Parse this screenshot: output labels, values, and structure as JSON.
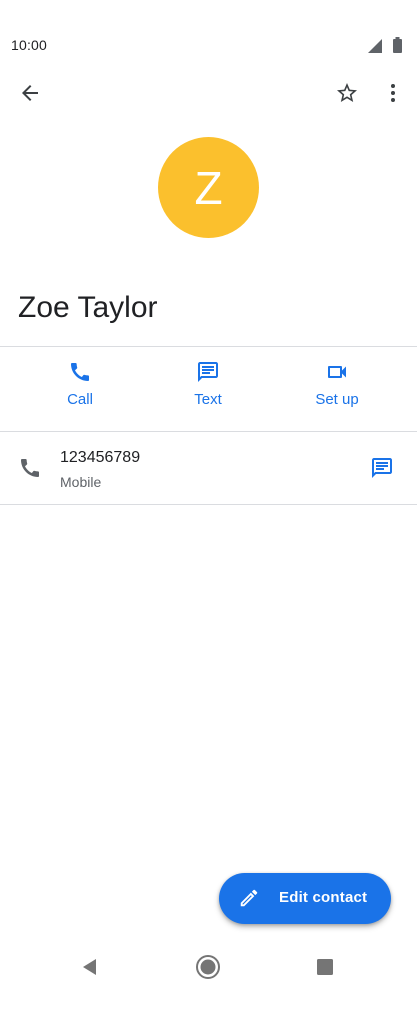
{
  "status_bar": {
    "time": "10:00",
    "signal_icon": "signal-icon",
    "battery_icon": "battery-icon"
  },
  "app_bar": {
    "back_icon": "arrow-back-icon",
    "favorite_icon": "star-outline-icon",
    "more_icon": "more-vert-icon"
  },
  "contact": {
    "avatar_letter": "Z",
    "avatar_color": "#fbc02d",
    "name": "Zoe Taylor"
  },
  "actions": [
    {
      "label": "Call",
      "icon": "phone-icon"
    },
    {
      "label": "Text",
      "icon": "message-icon"
    },
    {
      "label": "Set up",
      "icon": "videocam-icon"
    }
  ],
  "phone_entry": {
    "number": "123456789",
    "type": "Mobile",
    "icon": "phone-icon",
    "action_icon": "message-icon"
  },
  "fab": {
    "label": "Edit contact",
    "icon": "pencil-icon",
    "color": "#1a73e8"
  },
  "nav_bar": {
    "back_icon": "nav-back-icon",
    "home_icon": "nav-home-icon",
    "recents_icon": "nav-recents-icon"
  },
  "colors": {
    "accent": "#1a73e8",
    "divider": "#dadce0",
    "text_primary": "#202124",
    "text_secondary": "#5f6368"
  }
}
